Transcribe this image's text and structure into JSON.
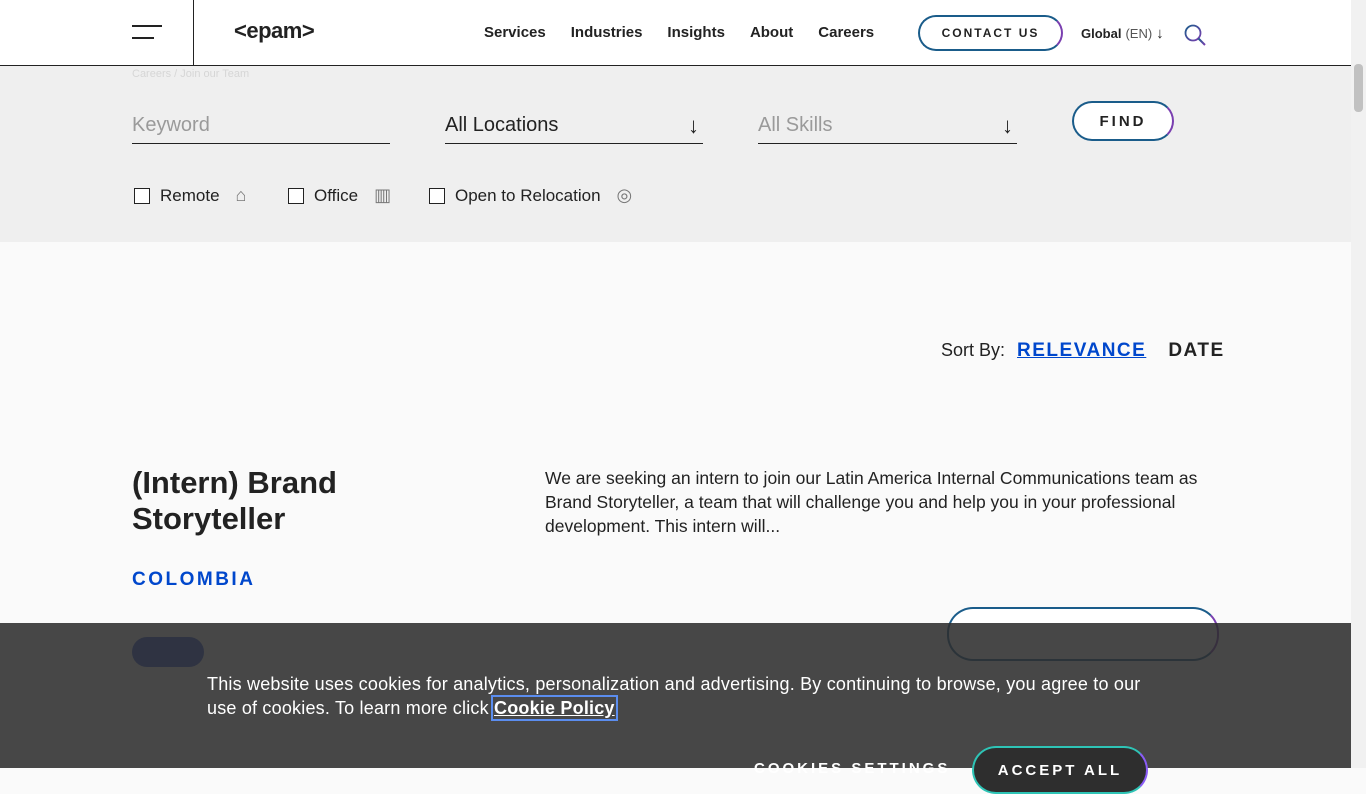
{
  "header": {
    "logo": "<epam>",
    "nav": [
      "Services",
      "Industries",
      "Insights",
      "About",
      "Careers"
    ],
    "contact_label": "CONTACT US",
    "region_label": "Global",
    "region_lang": "(EN)"
  },
  "filters": {
    "breadcrumb_ghost": "Careers / Join our Team",
    "keyword_placeholder": "Keyword",
    "location_value": "All Locations",
    "skills_placeholder": "All Skills",
    "find_label": "FIND",
    "checkboxes": [
      "Remote",
      "Office",
      "Open to Relocation"
    ]
  },
  "sort": {
    "label": "Sort By:",
    "relevance": "RELEVANCE",
    "date": "DATE"
  },
  "job": {
    "title": "(Intern) Brand Storyteller",
    "country": "COLOMBIA",
    "description": "We are seeking an intern to join our Latin America Internal Communications team as Brand Storyteller, a team that will challenge you and help you in your professional development. This intern will..."
  },
  "cookie": {
    "text": "This website uses cookies for analytics, personalization and advertising. By continuing to browse, you agree to our use of cookies. To learn more click ",
    "link": "Cookie Policy",
    "settings_label": "COOKIES SETTINGS",
    "accept_label": "ACCEPT ALL"
  },
  "colors": {
    "accent_blue": "#0047cc",
    "gradient_start": "#1a5c8a",
    "gradient_end": "#7a3fb0",
    "cookie_bg": "#2e2e2e"
  }
}
